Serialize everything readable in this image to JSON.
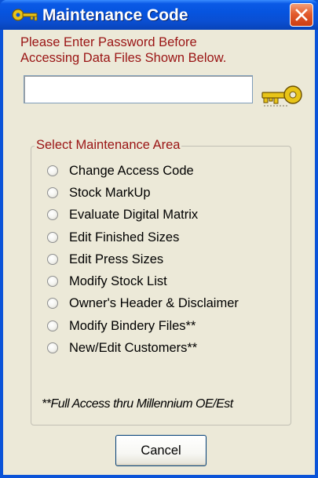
{
  "window": {
    "title": "Maintenance Code",
    "title_icon": "key-icon",
    "close_icon": "close-icon"
  },
  "prompt": {
    "line1": "Please Enter Password Before",
    "line2": "Accessing Data Files Shown Below."
  },
  "password": {
    "value": "",
    "placeholder": ""
  },
  "group": {
    "legend": "Select Maintenance Area",
    "options": [
      {
        "label": "Change Access Code"
      },
      {
        "label": "Stock MarkUp"
      },
      {
        "label": "Evaluate Digital Matrix"
      },
      {
        "label": "Edit Finished Sizes"
      },
      {
        "label": "Edit Press Sizes"
      },
      {
        "label": "Modify Stock List"
      },
      {
        "label": "Owner's Header & Disclaimer"
      },
      {
        "label": "Modify Bindery Files**"
      },
      {
        "label": "New/Edit Customers**"
      }
    ],
    "footnote": "**Full Access thru Millennium OE/Est"
  },
  "buttons": {
    "cancel_label": "Cancel"
  },
  "colors": {
    "title_bar": "#0654df",
    "client_background": "#ece9d8",
    "prompt_text": "#9a1414",
    "close_button": "#e35c2e",
    "key_gold": "#e8c418"
  }
}
